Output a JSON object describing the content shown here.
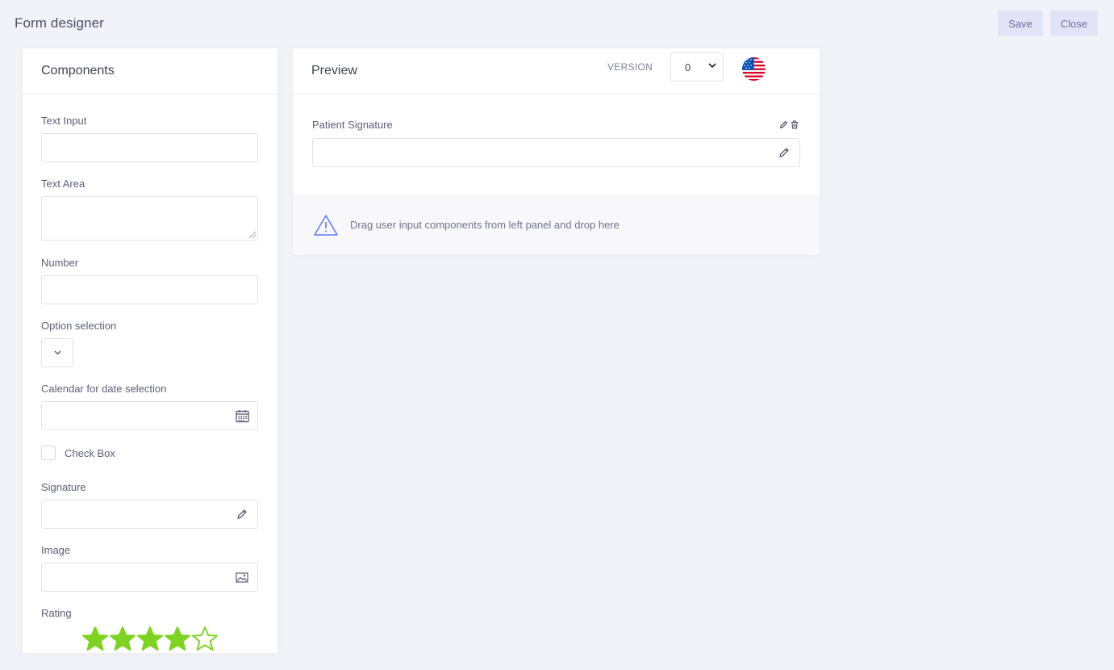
{
  "page": {
    "title": "Form designer"
  },
  "toolbar": {
    "save_label": "Save",
    "close_label": "Close"
  },
  "components": {
    "title": "Components",
    "text_input_label": "Text Input",
    "text_area_label": "Text Area",
    "number_label": "Number",
    "option_selection_label": "Option selection",
    "calendar_label": "Calendar for date selection",
    "checkbox_label": "Check Box",
    "signature_label": "Signature",
    "image_label": "Image",
    "rating_label": "Rating",
    "rating": {
      "value": 4,
      "max": 5,
      "color": "#7ed321"
    }
  },
  "preview": {
    "title": "Preview",
    "version_label": "VERSION",
    "version_value": "0",
    "language_icon": "us-flag-icon",
    "field_label": "Patient Signature",
    "drop_hint": "Drag user input components from left panel and drop here"
  },
  "colors": {
    "accent": "#5d78ff",
    "button_bg": "#e1e3f6",
    "page_bg": "#f2f3f8"
  }
}
